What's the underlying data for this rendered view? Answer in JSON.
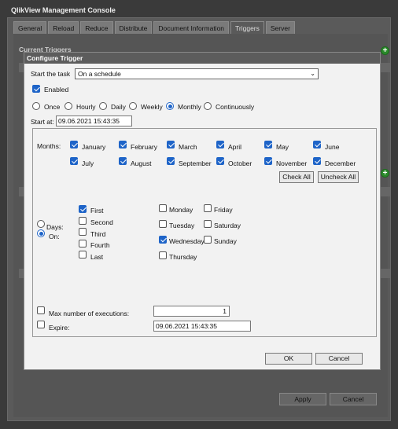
{
  "app": {
    "title": "QlikView Management Console"
  },
  "tabs": [
    "General",
    "Reload",
    "Reduce",
    "Distribute",
    "Document Information",
    "Triggers",
    "Server"
  ],
  "background": {
    "current_triggers": "Current Triggers",
    "apply": "Apply",
    "cancel": "Cancel"
  },
  "dialog": {
    "title": "Configure Trigger",
    "start_label": "Start the task",
    "start_value": "On a schedule",
    "enabled_label": "Enabled",
    "frequency": [
      "Once",
      "Hourly",
      "Daily",
      "Weekly",
      "Monthly",
      "Continuously"
    ],
    "frequency_selected": "Monthly",
    "start_at_label": "Start at:",
    "start_at_value": "09.06.2021 15:43:35",
    "months_label": "Months:",
    "months": [
      "January",
      "February",
      "March",
      "April",
      "May",
      "June",
      "July",
      "August",
      "September",
      "October",
      "November",
      "December"
    ],
    "check_all": "Check All",
    "uncheck_all": "Uncheck All",
    "days_label": "Days:",
    "on_label": "On:",
    "ordinals": [
      {
        "label": "First",
        "checked": true
      },
      {
        "label": "Second",
        "checked": false
      },
      {
        "label": "Third",
        "checked": false
      },
      {
        "label": "Fourth",
        "checked": false
      },
      {
        "label": "Last",
        "checked": false
      }
    ],
    "weekdays": [
      {
        "label": "Monday",
        "checked": false
      },
      {
        "label": "Tuesday",
        "checked": false
      },
      {
        "label": "Wednesday",
        "checked": true
      },
      {
        "label": "Thursday",
        "checked": false
      },
      {
        "label": "Friday",
        "checked": false
      },
      {
        "label": "Saturday",
        "checked": false
      },
      {
        "label": "Sunday",
        "checked": false
      }
    ],
    "max_exec_label": "Max number of executions:",
    "max_exec_value": "1",
    "expire_label": "Expire:",
    "expire_value": "09.06.2021 15:43:35",
    "ok": "OK",
    "cancel": "Cancel"
  }
}
